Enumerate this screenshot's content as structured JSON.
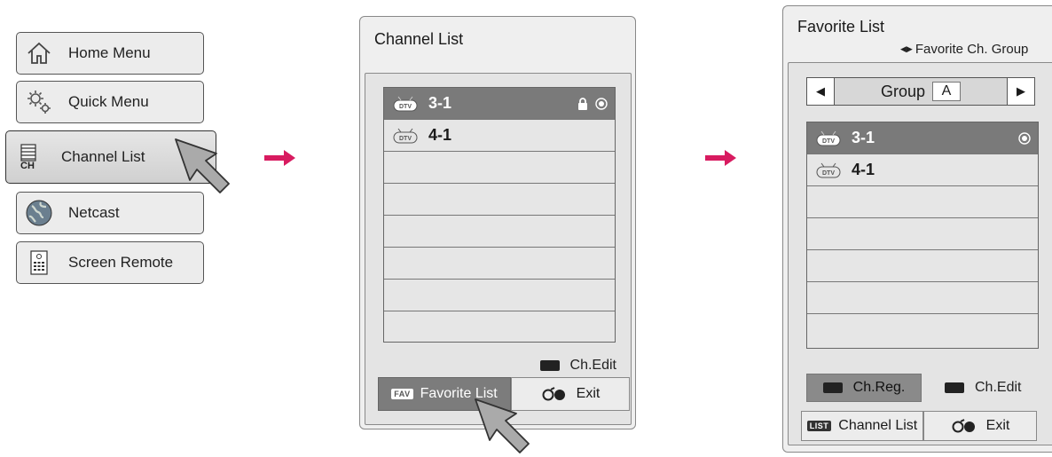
{
  "menu": {
    "items": [
      {
        "label": "Home Menu",
        "icon": "home-icon"
      },
      {
        "label": "Quick Menu",
        "icon": "gear-icon"
      },
      {
        "label": "Channel List",
        "icon": "channel-list-icon",
        "icon_text": "CH",
        "active": true
      },
      {
        "label": "Netcast",
        "icon": "globe-icon"
      },
      {
        "label": "Screen Remote",
        "icon": "remote-icon"
      }
    ]
  },
  "channel_list": {
    "title": "Channel List",
    "rows": [
      {
        "badge": "DTV",
        "number": "3-1",
        "selected": true,
        "locked": true,
        "marked": true
      },
      {
        "badge": "DTV",
        "number": "4-1",
        "selected": false,
        "locked": false,
        "marked": false
      }
    ],
    "ch_edit_label": "Ch.Edit",
    "favorite_badge": "FAV",
    "favorite_label": "Favorite List",
    "exit_label": "Exit"
  },
  "favorite_list": {
    "title": "Favorite List",
    "subtitle": "Favorite Ch. Group",
    "group_label": "Group",
    "group_value": "A",
    "rows": [
      {
        "badge": "DTV",
        "number": "3-1",
        "selected": true,
        "marked": true
      },
      {
        "badge": "DTV",
        "number": "4-1",
        "selected": false,
        "marked": false
      }
    ],
    "ch_reg_label": "Ch.Reg.",
    "ch_edit_label": "Ch.Edit",
    "channel_list_badge": "LIST",
    "channel_list_label": "Channel List",
    "exit_label": "Exit"
  },
  "colors": {
    "arrow": "#d81b60",
    "selected_row": "#7a7a7a",
    "panel_bg": "#efefef"
  }
}
